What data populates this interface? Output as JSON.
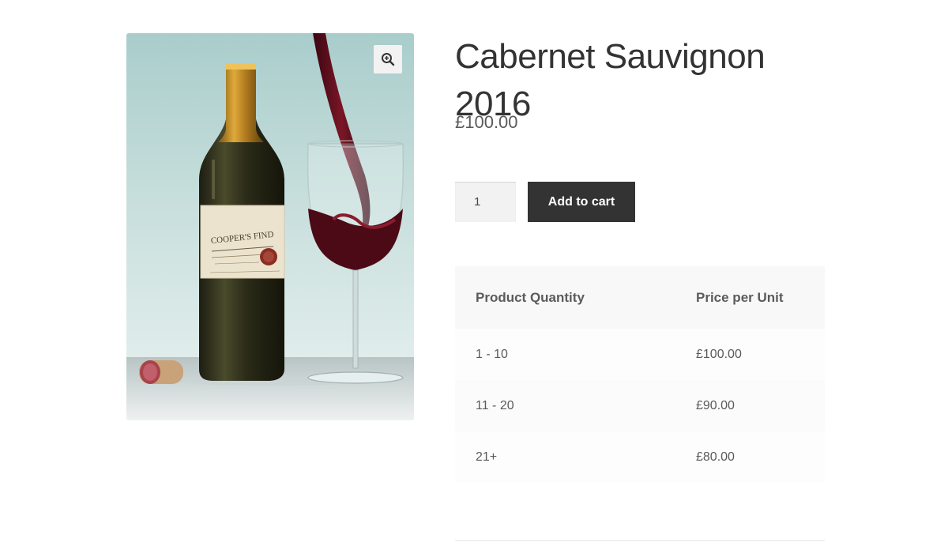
{
  "product": {
    "title": "Cabernet Sauvignon 2016",
    "price": "£100.00",
    "image_alt": "Cabernet Sauvignon bottle with glass"
  },
  "cart": {
    "quantity": "1",
    "add_to_cart_label": "Add to cart"
  },
  "gallery": {
    "zoom_icon": "zoom-in-icon"
  },
  "pricing_table": {
    "headers": [
      "Product Quantity",
      "Price per Unit"
    ],
    "rows": [
      {
        "quantity": "1 - 10",
        "price": "£100.00"
      },
      {
        "quantity": "11 - 20",
        "price": "£90.00"
      },
      {
        "quantity": "21+",
        "price": "£80.00"
      }
    ]
  },
  "colors": {
    "button_bg": "#333333",
    "button_text": "#ffffff",
    "table_header_bg": "#f8f8f8",
    "wine": "#5a0f1e"
  }
}
